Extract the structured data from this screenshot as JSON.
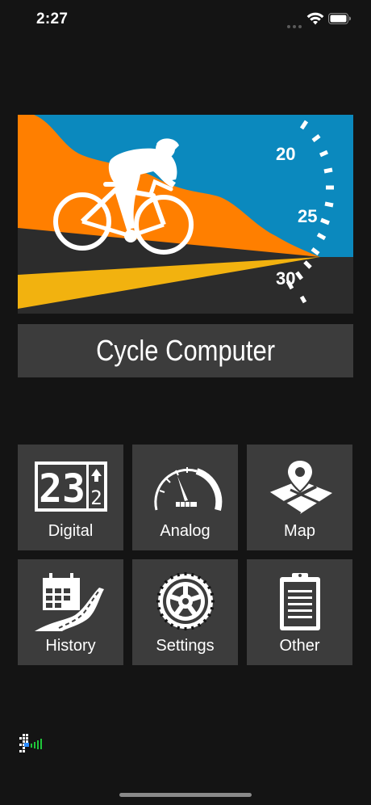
{
  "status_bar": {
    "time": "2:27",
    "icons": [
      "signal-dots-icon",
      "wifi-icon",
      "battery-icon"
    ]
  },
  "hero": {
    "speed_scale_labels": [
      "20",
      "25",
      "30"
    ],
    "colors": {
      "sky": "#0b89be",
      "hill": "#ff7f00",
      "road": "#2c2c2c",
      "road_stripe": "#f2b20f",
      "silhouette": "#ffffff"
    }
  },
  "app": {
    "title": "Cycle Computer"
  },
  "menu": {
    "items": [
      {
        "label": "Digital",
        "icon": "digital-display-icon"
      },
      {
        "label": "Analog",
        "icon": "analog-gauge-icon"
      },
      {
        "label": "Map",
        "icon": "map-pin-icon"
      },
      {
        "label": "History",
        "icon": "calendar-road-icon"
      },
      {
        "label": "Settings",
        "icon": "chainring-gear-icon"
      },
      {
        "label": "Other",
        "icon": "clipboard-icon"
      }
    ],
    "digital_icon_text": {
      "digits": "23",
      "gear": "2"
    }
  },
  "footer": {
    "gps_icon": "gps-signal-icon",
    "gps_color": "#1fc63a"
  }
}
